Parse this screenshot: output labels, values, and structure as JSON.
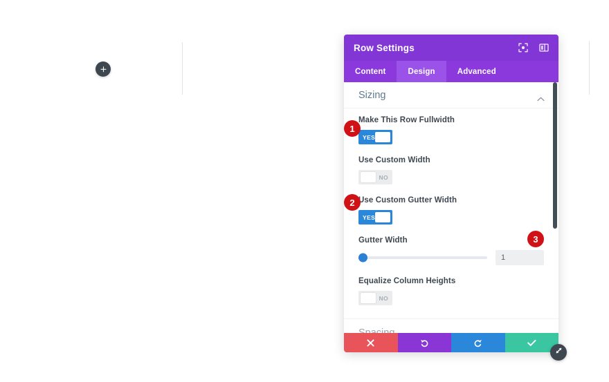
{
  "canvas": {
    "add_row_icon": "plus-icon"
  },
  "modal": {
    "title": "Row Settings",
    "header_icons": [
      {
        "name": "responsive-preview-icon"
      },
      {
        "name": "split-layout-icon"
      }
    ],
    "tabs": [
      {
        "label": "Content",
        "active": false
      },
      {
        "label": "Design",
        "active": true
      },
      {
        "label": "Advanced",
        "active": false
      }
    ],
    "sections": [
      {
        "title": "Sizing",
        "expanded": true
      },
      {
        "title": "Spacing",
        "expanded": false
      }
    ],
    "fields": [
      {
        "label": "Make This Row Fullwidth",
        "type": "toggle",
        "value": "YES",
        "state": "on"
      },
      {
        "label": "Use Custom Width",
        "type": "toggle",
        "value": "NO",
        "state": "off"
      },
      {
        "label": "Use Custom Gutter Width",
        "type": "toggle",
        "value": "YES",
        "state": "on"
      },
      {
        "label": "Gutter Width",
        "type": "slider",
        "value": "1",
        "slider_percent": 0
      },
      {
        "label": "Equalize Column Heights",
        "type": "toggle",
        "value": "NO",
        "state": "off"
      }
    ],
    "actions": [
      {
        "name": "cancel-button",
        "icon": "close-icon"
      },
      {
        "name": "undo-button",
        "icon": "undo-icon"
      },
      {
        "name": "redo-button",
        "icon": "redo-icon"
      },
      {
        "name": "save-button",
        "icon": "check-icon"
      }
    ],
    "resize_handle_icon": "resize-diagonal-icon"
  },
  "annotations": [
    {
      "number": "1"
    },
    {
      "number": "2"
    },
    {
      "number": "3"
    }
  ],
  "colors": {
    "header_purple": "#8336d6",
    "tab_bar_purple": "#8b38dd",
    "tab_active_purple": "#9b52e8",
    "toggle_on_blue": "#2b87da",
    "slider_blue": "#2b7fd4",
    "badge_red": "#d01217",
    "cancel_red": "#e9535a",
    "undo_purple": "#8a35d6",
    "redo_blue": "#2b87da",
    "save_green": "#39c6a0",
    "section_title_blue": "#5e7a90"
  }
}
